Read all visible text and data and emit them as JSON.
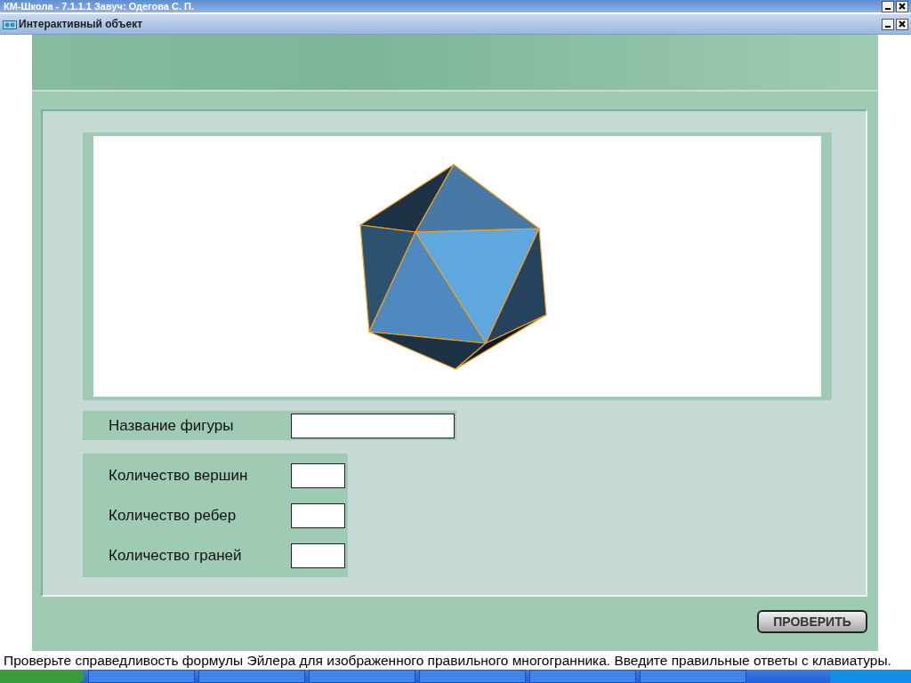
{
  "outer_window": {
    "title": "КМ-Школа - 7.1.1.1 Завуч: Одегова С. П."
  },
  "window": {
    "title": "Интерактивный объект"
  },
  "name_field": {
    "label": "Название фигуры"
  },
  "count_fields": [
    {
      "label": "Количество вершин"
    },
    {
      "label": "Количество ребер"
    },
    {
      "label": "Количество граней"
    }
  ],
  "check_button": {
    "label": "ПРОВЕРИТЬ"
  },
  "instruction": "Проверьте справедливость формулы Эйлера для изображенного правильного многогранника.  Введите правильные ответы с клавиатуры."
}
